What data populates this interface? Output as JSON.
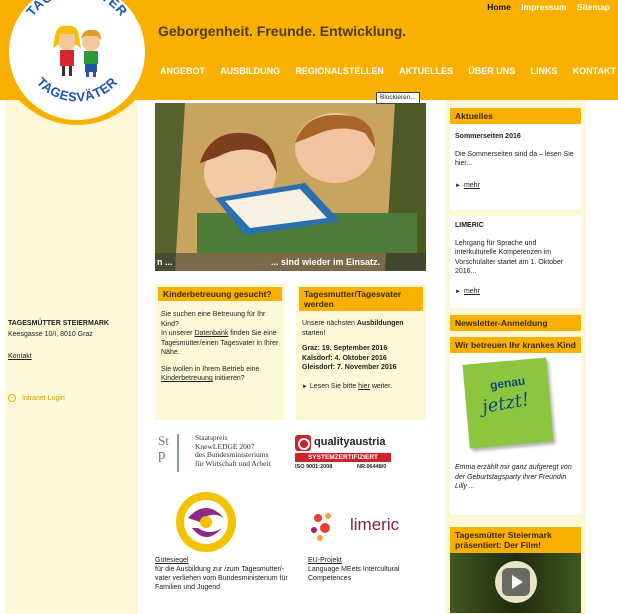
{
  "top_links": [
    {
      "label": "Home"
    },
    {
      "label": "Impressum"
    },
    {
      "label": "Sitemap"
    }
  ],
  "slogan": "Geborgenheit. Freunde. Entwicklung.",
  "logo": {
    "top_text": "TAGESMÜTTER",
    "bottom_text": "TAGESVÄTER"
  },
  "nav": [
    "ANGEBOT",
    "AUSBILDUNG",
    "REGIONALSTELLEN",
    "AKTUELLES",
    "ÜBER UNS",
    "LINKS",
    "KONTAKT"
  ],
  "left": {
    "org": "TAGESMÜTTER STEIERMARK",
    "address": "Keesgasse 10/I, 8010 Graz",
    "kontakt": "Kontakt",
    "intranet": "Intranet Login"
  },
  "hero": {
    "block_label": "Blockieren...",
    "caption_left": "n ...",
    "caption_right": "... sind wieder im Einsatz."
  },
  "box1": {
    "title": "Kinderbetreuung gesucht?",
    "p1a": "Sie suchen eine Betreuung für Ihr Kind?",
    "p1b": "In unserer",
    "p1link": "Datenbank",
    "p1c": "finden Sie eine Tagesmutter/einen Tagesvater in Ihrer Nähe.",
    "p2a": "Sie wollen in Ihrem Betrieb eine",
    "p2link": "Kinderbetreuung",
    "p2b": "initiieren?"
  },
  "box2": {
    "title": "Tagesmutter/Tagesvater werden",
    "p1a": "Unsere nächsten",
    "p1bold": "Ausbildungen",
    "p1b": "starten!",
    "dates": [
      "Graz: 19. September 2016",
      "Kalsdorf: 4. Oktober 2016",
      "Gleisdorf: 7. November 2016"
    ],
    "more_a": "Lesen Sie bitte",
    "more_link": "hier",
    "more_b": "weiter."
  },
  "logos": {
    "staatspreis": [
      "Staatspreis",
      "KnewLEDGE 2007",
      "des Bundesministeriums",
      "für Wirtschaft und Arbeit"
    ],
    "sp_mark": "St",
    "qa_name": "qualityaustria",
    "qa_bar": "SYSTEMZERTIFIZIERT",
    "qa_iso": "ISO 9001:2008",
    "qa_nr": "NR.06448/0",
    "limeric": "limeric"
  },
  "guetesiegel": {
    "link": "Gütesiegel",
    "text": "für die Ausbildung zur /zum Tagesmutter/-vater verliehen vom Bundesministerium für Familien und Jugend"
  },
  "euprojekt": {
    "link": "EU-Projekt",
    "text": "Language MEets Intercultural Competences"
  },
  "right": {
    "aktuelles_title": "Aktuelles",
    "news1_title": "Sommerseiten 2016",
    "news1_text": "Die Sommerseiten sind da – lesen Sie hier...",
    "news2_title": "LIMERIC",
    "news2_text": "Lehrgang für Sprache und interkulturelle Kompetenzen im Vorschulalter startet am 1. Oktober 2016...",
    "more": "mehr",
    "newsletter": "Newsletter-Anmeldung",
    "sick_title": "Wir betreuen Ihr krankes Kind",
    "sticky_top": "genau",
    "sticky_bottom": "jetzt!",
    "sick_text": "Emma erzählt mir ganz aufgeregt von der Geburtstagsparty ihrer Freundin Lilly ...",
    "film_title": "Tagesmütter Steiermark präsentiert: Der Film!"
  },
  "colors": {
    "brand": "#f9b000",
    "panel": "#fff8d6",
    "sticky": "#8cc63f"
  }
}
